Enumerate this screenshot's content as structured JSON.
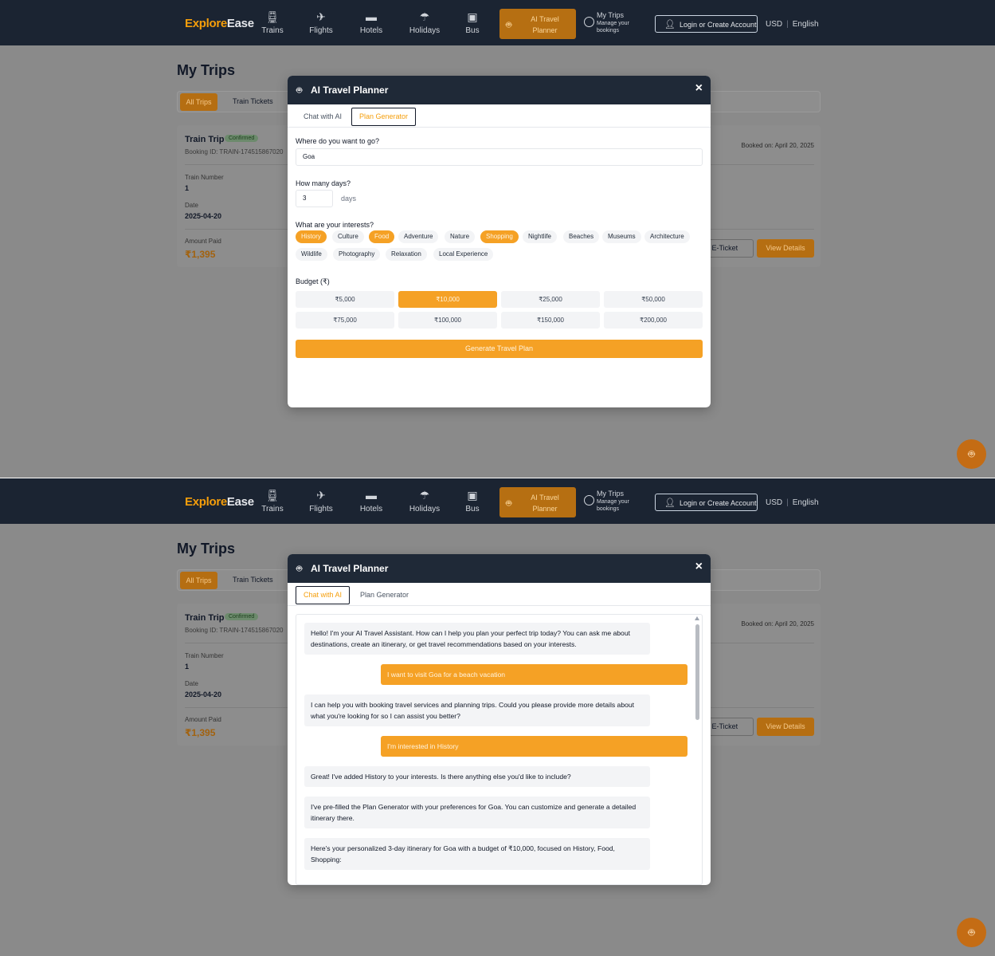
{
  "header": {
    "logo_a": "Explore",
    "logo_b": "Ease",
    "nav": [
      {
        "label": "Trains",
        "icon": "train-icon"
      },
      {
        "label": "Flights",
        "icon": "plane-icon"
      },
      {
        "label": "Holidays",
        "icon": "umbrella-icon"
      },
      {
        "label": "Bus",
        "icon": "bus-icon"
      }
    ],
    "hotels_label": "Hotels",
    "ai_planner_label": "AI Travel Planner",
    "mytrips_title": "My Trips",
    "mytrips_sub": "Manage your bookings",
    "login_label": "Login or Create Account",
    "currency": "USD",
    "language": "English"
  },
  "page": {
    "title": "My Trips",
    "tab_all": "All Trips",
    "tab_train": "Train Tickets",
    "trip": {
      "title": "Train Trip",
      "status": "Confirmed",
      "booking_id": "Booking ID: TRAIN-174515867020",
      "booked_on": "Booked on: April 20, 2025",
      "train_number_label": "Train Number",
      "train_number": "1",
      "date_label": "Date",
      "date": "2025-04-20",
      "amount_label": "Amount Paid",
      "amount": "₹1,395",
      "download_label": "d E-Ticket",
      "view_label": "View Details"
    }
  },
  "modal": {
    "title": "AI Travel Planner",
    "close": "×",
    "tab_chat": "Chat with AI",
    "tab_plan": "Plan Generator",
    "plan": {
      "dest_label": "Where do you want to go?",
      "dest_value": "Goa",
      "days_label": "How many days?",
      "days_value": "3",
      "days_unit": "days",
      "interests_label": "What are your interests?",
      "interests_row1": [
        {
          "label": "History",
          "selected": true
        },
        {
          "label": "Culture",
          "selected": false
        },
        {
          "label": "Food",
          "selected": true
        },
        {
          "label": "Adventure",
          "selected": false
        },
        {
          "label": "Nature",
          "selected": false
        },
        {
          "label": "Shopping",
          "selected": true
        },
        {
          "label": "Nightlife",
          "selected": false
        },
        {
          "label": "Beaches",
          "selected": false
        },
        {
          "label": "Museums",
          "selected": false
        },
        {
          "label": "Architecture",
          "selected": false
        }
      ],
      "interests_row2": [
        {
          "label": "Wildlife",
          "selected": false
        },
        {
          "label": "Photography",
          "selected": false
        },
        {
          "label": "Relaxation",
          "selected": false
        },
        {
          "label": "Local Experience",
          "selected": false
        }
      ],
      "budget_label": "Budget (₹)",
      "budget_options": [
        {
          "label": "₹5,000",
          "selected": false
        },
        {
          "label": "₹10,000",
          "selected": true
        },
        {
          "label": "₹25,000",
          "selected": false
        },
        {
          "label": "₹50,000",
          "selected": false
        },
        {
          "label": "₹75,000",
          "selected": false
        },
        {
          "label": "₹100,000",
          "selected": false
        },
        {
          "label": "₹150,000",
          "selected": false
        },
        {
          "label": "₹200,000",
          "selected": false
        }
      ],
      "generate_label": "Generate Travel Plan"
    },
    "chat": [
      {
        "role": "bot",
        "text": "Hello! I'm your AI Travel Assistant. How can I help you plan your perfect trip today? You can ask me about destinations, create an itinerary, or get travel recommendations based on your interests."
      },
      {
        "role": "user",
        "text": "I want to visit Goa for a beach vacation"
      },
      {
        "role": "bot",
        "text": "I can help you with booking travel services and planning trips. Could you please provide more details about what you're looking for so I can assist you better?"
      },
      {
        "role": "user",
        "text": "I'm interested in History"
      },
      {
        "role": "bot",
        "text": "Great! I've added History to your interests. Is there anything else you'd like to include?"
      },
      {
        "role": "bot",
        "text": "I've pre-filled the Plan Generator with your preferences for Goa. You can customize and generate a detailed itinerary there."
      },
      {
        "role": "bot",
        "text": "Here's your personalized 3-day itinerary for Goa with a budget of ₹10,000, focused on History, Food, Shopping:"
      }
    ]
  },
  "colors": {
    "accent": "#f5a125",
    "header_bg": "#1b2432",
    "overlay": "#8a8a8a"
  }
}
